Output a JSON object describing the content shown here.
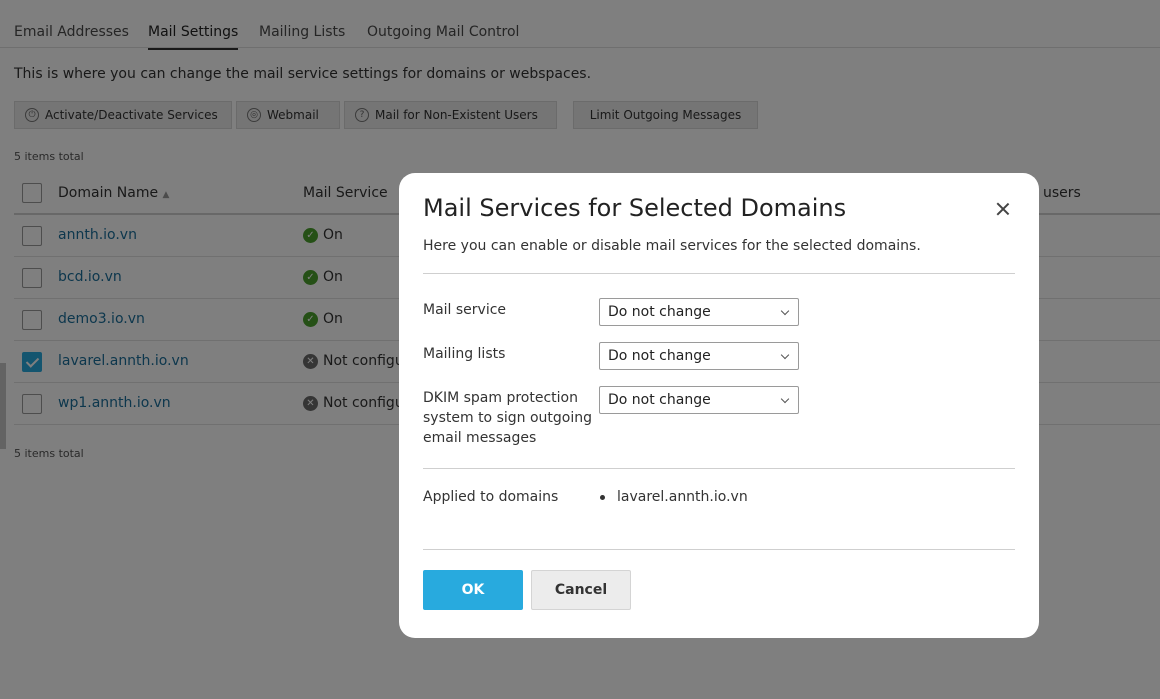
{
  "tabs": [
    "Email Addresses",
    "Mail Settings",
    "Mailing Lists",
    "Outgoing Mail Control"
  ],
  "active_tab": "Mail Settings",
  "intro_text": "This is where you can change the mail service settings for domains or webspaces.",
  "toolbar": {
    "activate_label": "Activate/Deactivate Services",
    "webmail_label": "Webmail",
    "nonexistent_label": "Mail for Non-Existent Users",
    "limit_label": "Limit Outgoing Messages"
  },
  "items_total": "5 items total",
  "table": {
    "columns": [
      "Domain Name",
      "Mail Service"
    ],
    "partial_column": "users",
    "rows": [
      {
        "domain": "annth.io.vn",
        "status": "On",
        "checked": false
      },
      {
        "domain": "bcd.io.vn",
        "status": "On",
        "checked": false
      },
      {
        "domain": "demo3.io.vn",
        "status": "On",
        "checked": false
      },
      {
        "domain": "lavarel.annth.io.vn",
        "status": "Not configu",
        "checked": true
      },
      {
        "domain": "wp1.annth.io.vn",
        "status": "Not configu",
        "checked": false
      }
    ]
  },
  "modal": {
    "title": "Mail Services for Selected Domains",
    "description": "Here you can enable or disable mail services for the selected domains.",
    "fields": [
      {
        "label": "Mail service",
        "value": "Do not change"
      },
      {
        "label": "Mailing lists",
        "value": "Do not change"
      },
      {
        "label": "DKIM spam protection system to sign outgoing email messages",
        "value": "Do not change"
      }
    ],
    "applied_label": "Applied to domains",
    "applied_domains": [
      "lavarel.annth.io.vn"
    ],
    "ok_label": "OK",
    "cancel_label": "Cancel"
  },
  "colors": {
    "accent": "#28aade",
    "link": "#1a6e9a",
    "status_on": "#4aa02c",
    "status_off": "#6b6b6b"
  },
  "icons": [
    "power-icon",
    "globe-icon",
    "question-icon",
    "check-circle-icon",
    "x-circle-icon",
    "sort-arrow-icon",
    "close-icon",
    "chevron-down-icon"
  ]
}
